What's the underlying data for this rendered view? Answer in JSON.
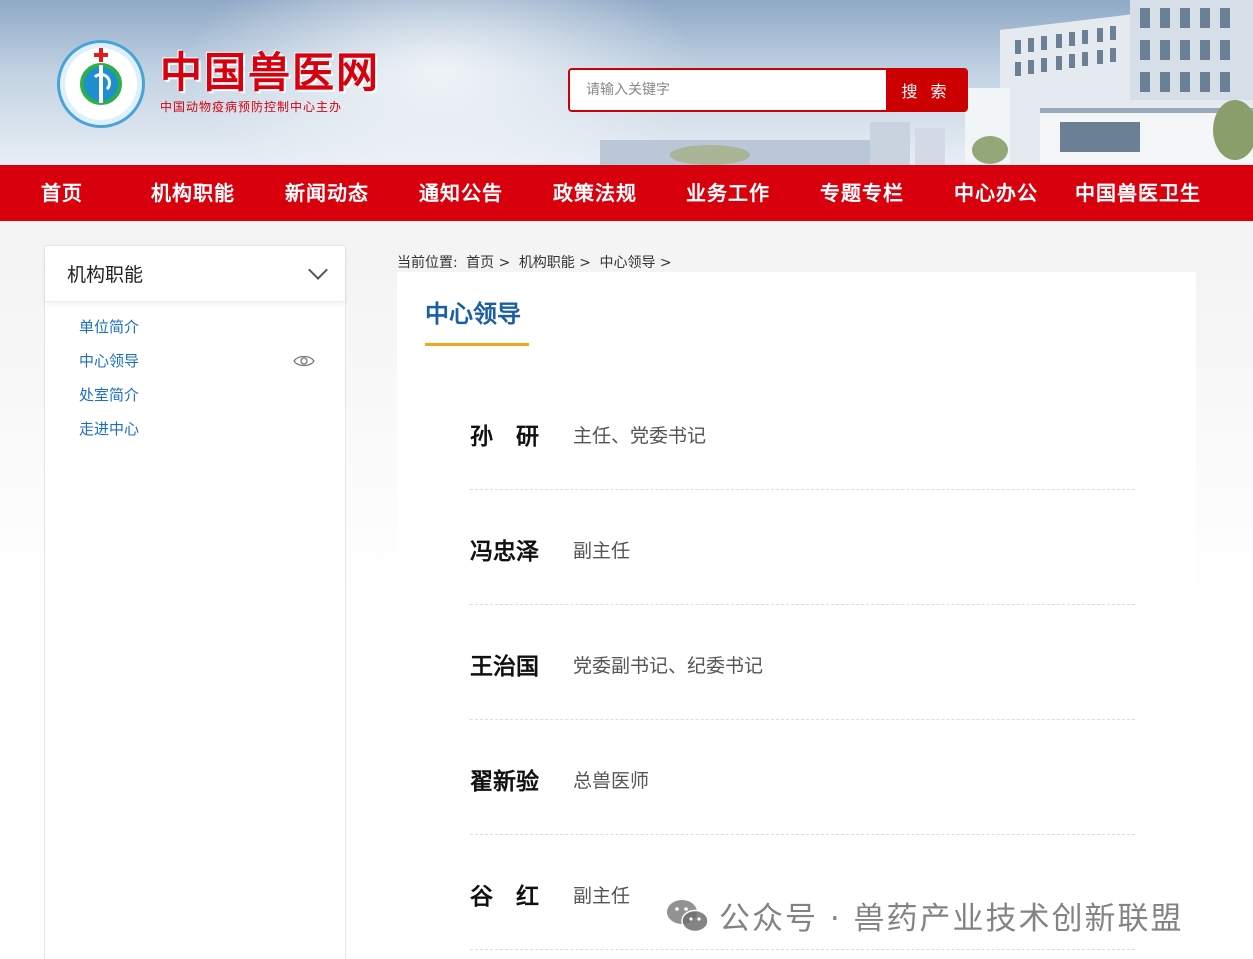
{
  "header": {
    "logo_title": "中国兽医网",
    "logo_subtitle": "中国动物疫病预防控制中心主办",
    "search_placeholder": "请输入关键字",
    "search_button": "搜 索"
  },
  "nav": {
    "items": [
      "首页",
      "机构职能",
      "新闻动态",
      "通知公告",
      "政策法规",
      "业务工作",
      "专题专栏",
      "中心办公",
      "中国兽医卫生"
    ]
  },
  "sidebar": {
    "title": "机构职能",
    "items": [
      "单位简介",
      "中心领导",
      "处室简介",
      "走进中心"
    ]
  },
  "breadcrumb": {
    "prefix": "当前位置:",
    "items": [
      "首页 >",
      "机构职能 >",
      "中心领导 >"
    ]
  },
  "content": {
    "title": "中心领导",
    "leaders": [
      {
        "name": "孙　研",
        "title": "主任、党委书记"
      },
      {
        "name": "冯忠泽",
        "title": "副主任"
      },
      {
        "name": "王治国",
        "title": "党委副书记、纪委书记"
      },
      {
        "name": "翟新验",
        "title": "总兽医师"
      },
      {
        "name": "谷　红",
        "title": "副主任"
      }
    ]
  },
  "watermark": {
    "text": "公众号 · 兽药产业技术创新联盟"
  },
  "colors": {
    "brand_red": "#d8000d",
    "link_blue": "#1a6fc4",
    "title_blue": "#1a5ea8",
    "accent_orange": "#f3a51c"
  }
}
